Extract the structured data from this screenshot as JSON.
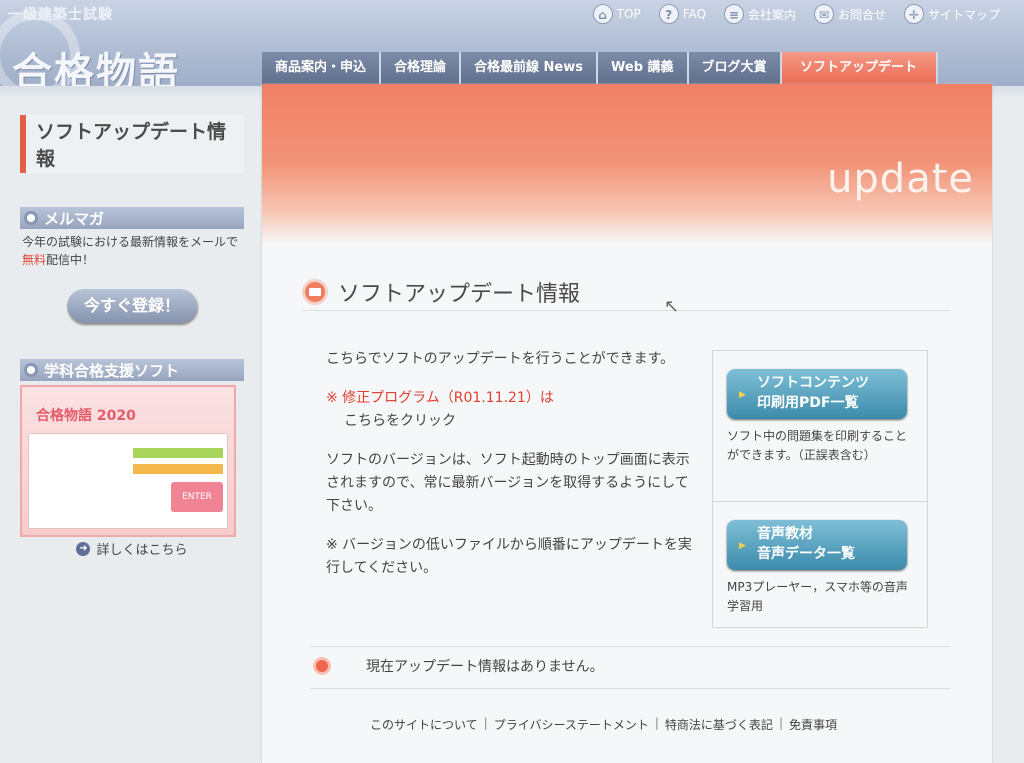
{
  "header": {
    "subtitle": "一級建築士試験",
    "logo": "合格物語",
    "top_nav": [
      {
        "label": "TOP",
        "icon": "⌂"
      },
      {
        "label": "FAQ",
        "icon": "?"
      },
      {
        "label": "会社案内",
        "icon": "≡"
      },
      {
        "label": "お問合せ",
        "icon": "✉"
      },
      {
        "label": "サイトマップ",
        "icon": "✛"
      }
    ],
    "main_nav": [
      {
        "label": "商品案内・申込"
      },
      {
        "label": "合格理論"
      },
      {
        "label": "合格最前線 News"
      },
      {
        "label": "Web 講義"
      },
      {
        "label": "ブログ大賞"
      },
      {
        "label": "ソフトアップデート"
      }
    ]
  },
  "sidebar": {
    "heading": "ソフトアップデート情報",
    "mailmag": {
      "title": "メルマガ",
      "text_before": "今年の試験における最新情報をメールで",
      "text_red": "無料",
      "text_after": "配信中！",
      "button": "今すぐ登録！"
    },
    "support": {
      "title": "学科合格支援ソフト",
      "promo_title": "合格物語 2020",
      "promo_enter": "ENTER",
      "detail_link": "詳しくはこちら"
    }
  },
  "main": {
    "banner": "update",
    "title": "ソフトアップデート情報",
    "intro": "こちらでソフトのアップデートを行うことができます。",
    "notice_red": "※ 修正プログラム（R01.11.21）は",
    "notice_link": "こちらをクリック",
    "version_text": "ソフトのバージョンは、ソフト起動時のトップ画面に表示されますので、常に最新バージョンを取得するようにして下さい。",
    "order_text": "※ バージョンの低いファイルから順番にアップデートを実行してください。",
    "right_box": [
      {
        "button_line1": "ソフトコンテンツ",
        "button_line2": "印刷用PDF一覧",
        "desc": "ソフト中の問題集を印刷することができます。（正誤表含む）"
      },
      {
        "button_line1": "音声教材",
        "button_line2": "音声データ一覧",
        "desc": "MP3プレーヤー，スマホ等の音声学習用"
      }
    ],
    "status": "現在アップデート情報はありません。"
  },
  "footer": {
    "links": [
      "このサイトについて",
      "プライバシーステートメント",
      "特商法に基づく表記",
      "免責事項"
    ]
  }
}
